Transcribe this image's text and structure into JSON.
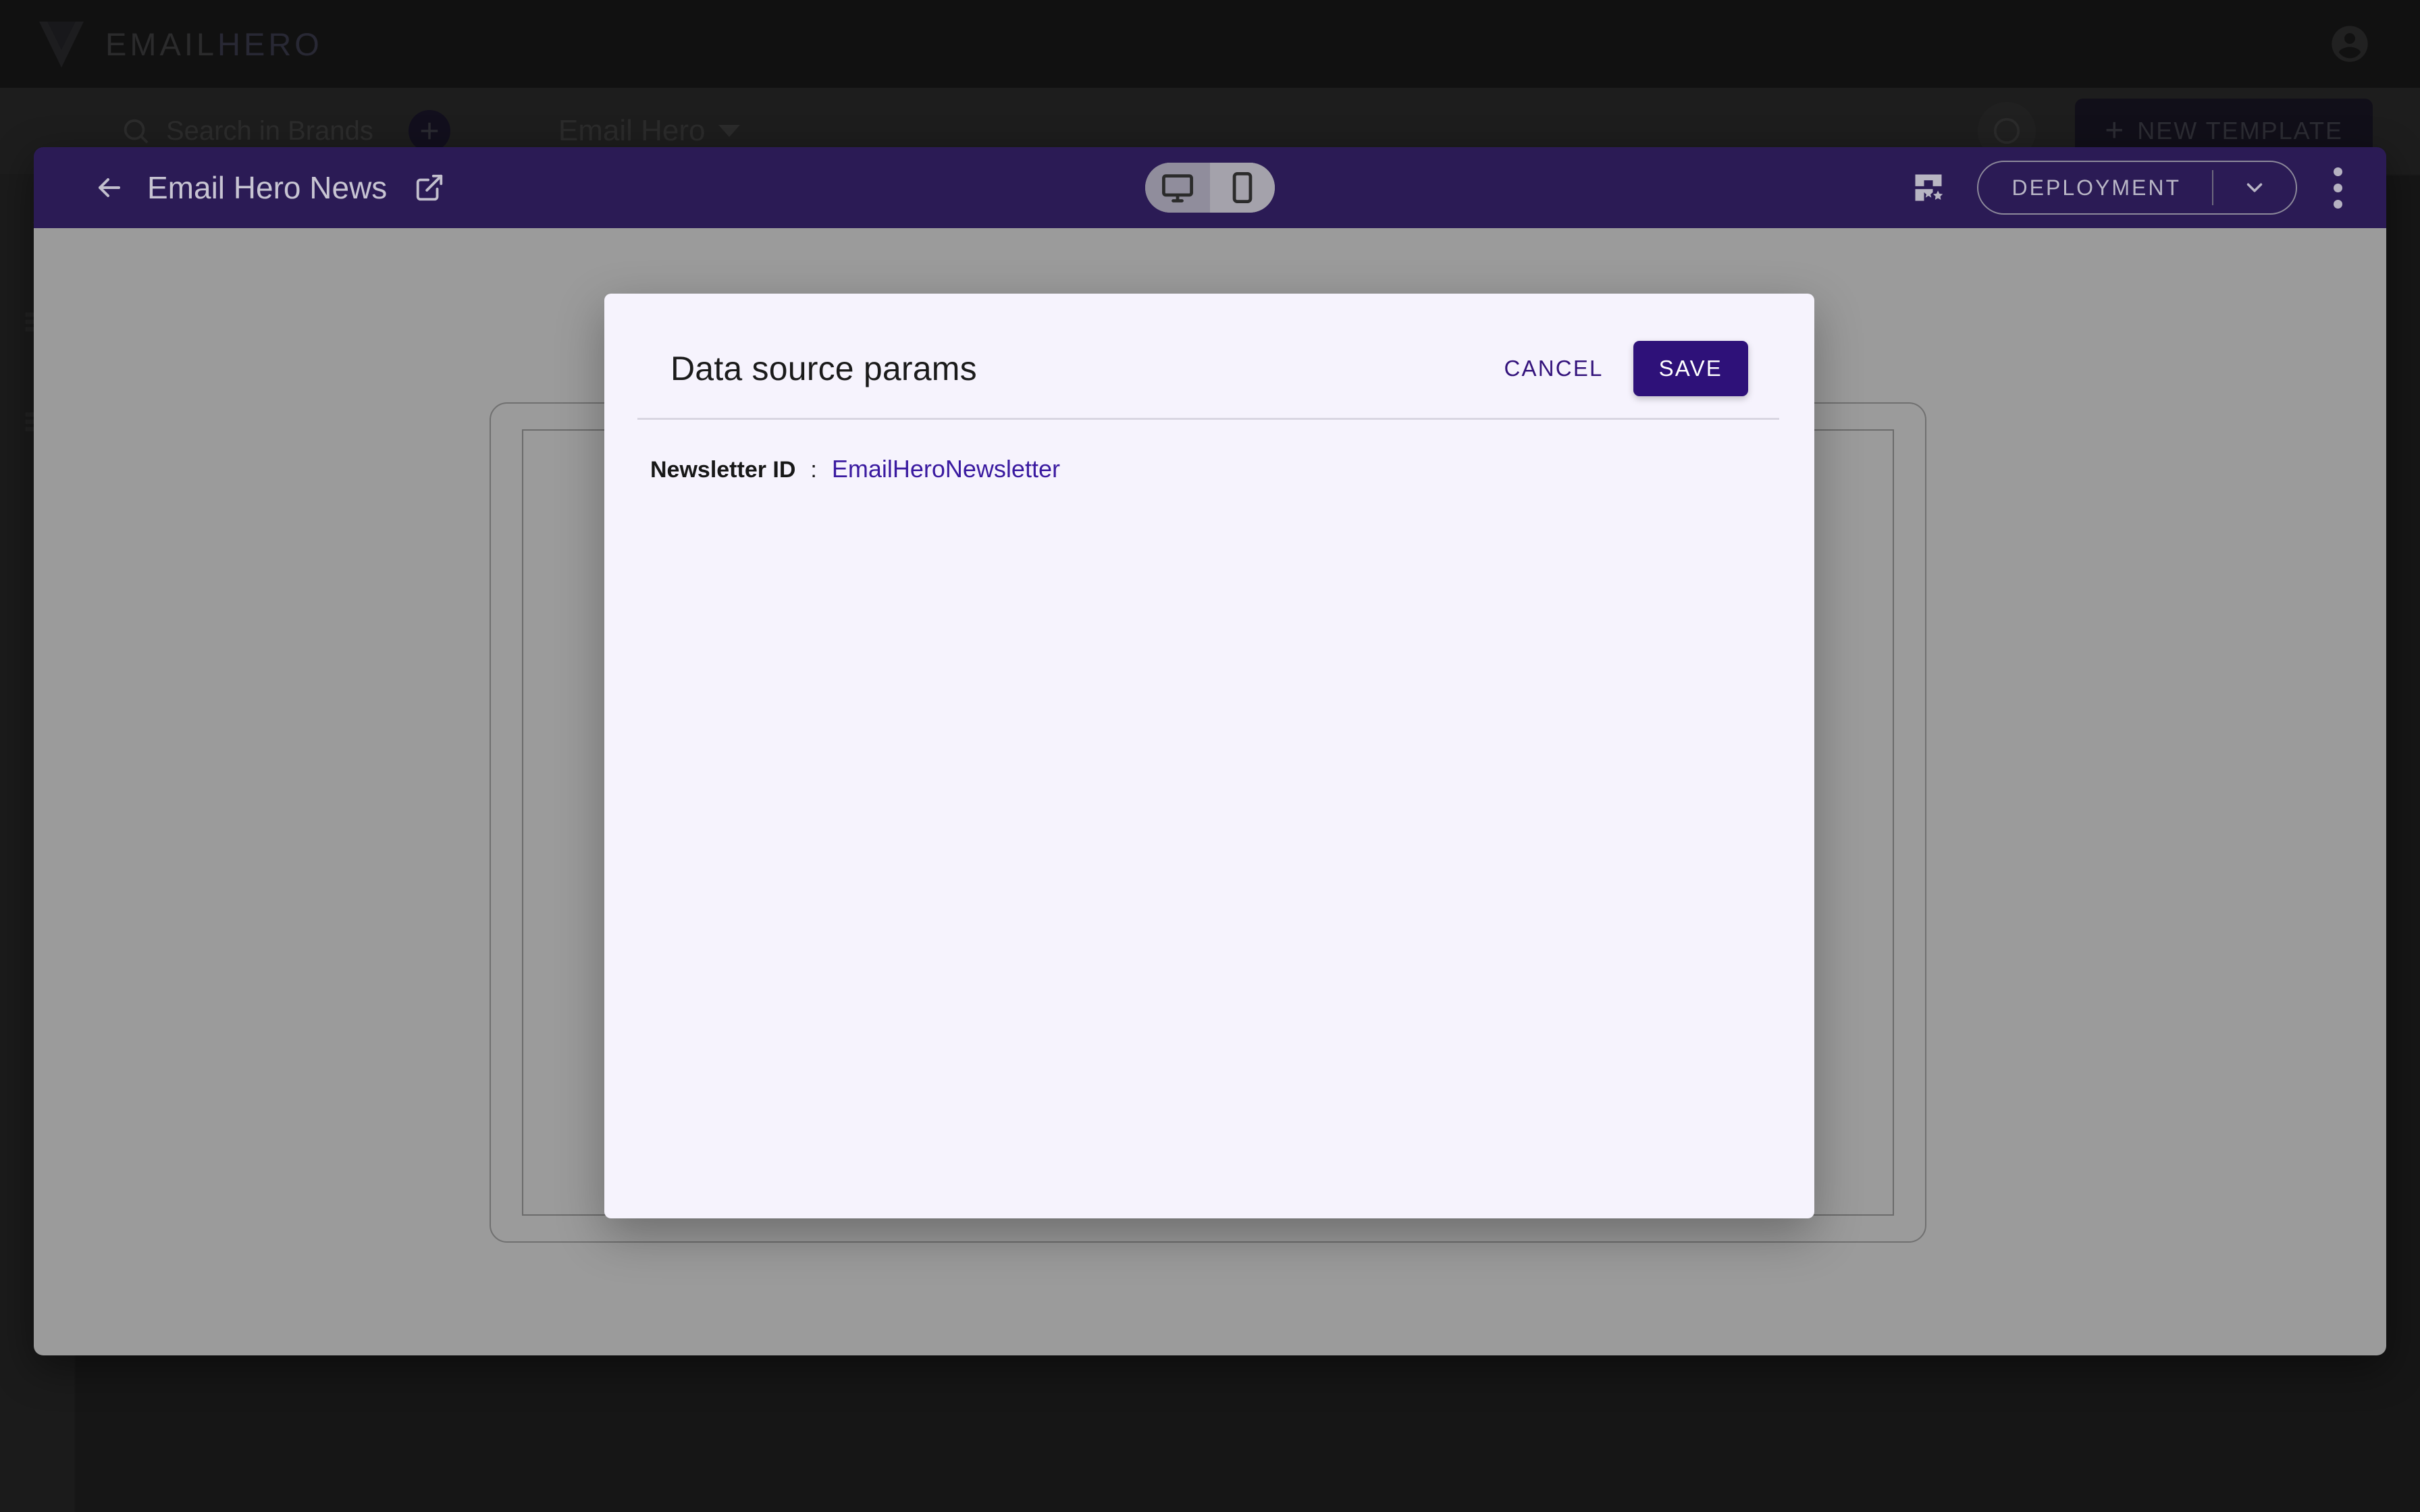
{
  "app": {
    "brand": {
      "prefix": "EMAIL",
      "suffix": "HERO"
    },
    "avatar_icon": "account-circle-icon",
    "rail_icons": [
      "clipboard-icon",
      "collapse-chevron-icon",
      "list-icon",
      "list-alt-icon"
    ],
    "search": {
      "placeholder": "Search in Brands",
      "icon": "search-icon"
    },
    "add_button_label": "+",
    "brand_selector": {
      "label": "Email Hero",
      "icon": "caret-down-icon"
    },
    "help_icon": "help-circle-icon",
    "new_template_button": {
      "plus": "+",
      "label": "NEW TEMPLATE"
    }
  },
  "editor": {
    "back_icon": "arrow-left-icon",
    "title": "Email Hero News",
    "open_external_icon": "open-in-new-icon",
    "device_toggle": {
      "options": [
        {
          "name": "desktop",
          "icon": "desktop-icon",
          "selected": true
        },
        {
          "name": "mobile",
          "icon": "smartphone-icon",
          "selected": false
        }
      ]
    },
    "table_star_icon": "table-star-icon",
    "deployment": {
      "label": "DEPLOYMENT",
      "caret_icon": "chevron-down-icon"
    },
    "more_menu_icon": "more-vertical-icon"
  },
  "modal": {
    "title": "Data source params",
    "cancel_label": "CANCEL",
    "save_label": "SAVE",
    "params": [
      {
        "label": "Newsletter ID",
        "separator": ":",
        "value": "EmailHeroNewsletter"
      }
    ]
  },
  "colors": {
    "appbar_purple": "#2b1b55",
    "accent_purple": "#2e1179",
    "value_purple": "#3a1aa0",
    "modal_bg": "#f6f3fd",
    "canvas_gray": "#9b9b9b"
  }
}
